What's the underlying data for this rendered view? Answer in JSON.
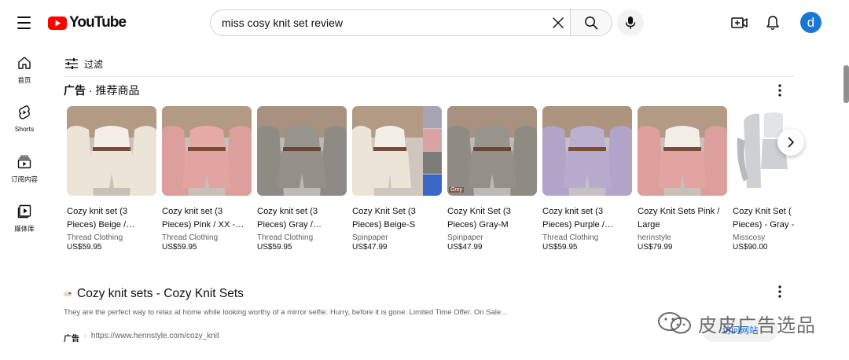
{
  "masthead": {
    "logo_text": "YouTube",
    "search_value": "miss cosy knit set review",
    "avatar_letter": "d",
    "avatar_color": "#1976d2",
    "brand_red": "#ff0000"
  },
  "guide": [
    {
      "label": "首页",
      "icon": "home-icon"
    },
    {
      "label": "Shorts",
      "icon": "shorts-icon"
    },
    {
      "label": "订阅内容",
      "icon": "subscriptions-icon"
    },
    {
      "label": "媒体库",
      "icon": "library-icon"
    }
  ],
  "filter": {
    "label": "过滤"
  },
  "shelf": {
    "ad_label": "广告",
    "separator": " · ",
    "title": "推荐商品",
    "products": [
      {
        "title": "Cozy knit set (3 Pieces) Beige /…",
        "seller": "Thread Clothing",
        "price": "US$59.95",
        "color": "cream"
      },
      {
        "title": "Cozy knit set (3 Pieces) Pink / XX -…",
        "seller": "Thread Clothing",
        "price": "US$59.95",
        "color": "pink"
      },
      {
        "title": "Cozy knit set (3 Pieces) Gray /…",
        "seller": "Thread Clothing",
        "price": "US$59.95",
        "color": "gray"
      },
      {
        "title": "Cozy Knit Set (3 Pieces) Beige-S",
        "seller": "Spinpaper",
        "price": "US$47.99",
        "color": "cream"
      },
      {
        "title": "Cozy Knit Set (3 Pieces) Gray-M",
        "seller": "Spinpaper",
        "price": "US$47.99",
        "color": "gray"
      },
      {
        "title": "Cozy knit set (3 Pieces) Purple /…",
        "seller": "Thread Clothing",
        "price": "US$59.95",
        "color": "purple"
      },
      {
        "title": "Cozy Knit Sets Pink / Large",
        "seller": "herinstyle",
        "price": "US$79.99",
        "color": "pink"
      },
      {
        "title": "Cozy Knit Set ( Pieces) - Gray -",
        "seller": "Misscosy",
        "price": "US$90.00",
        "color": "lightgray"
      }
    ],
    "thumb_badge": "Grey"
  },
  "text_ad": {
    "title": "Cozy knit sets - Cozy Knit Sets",
    "description": "They are the perfect way to relax at home while looking worthy of a mirror selfie. Hurry, before it is gone. Limited Time Offer. On Sale...",
    "badge": "广告",
    "url_prefix": " · ",
    "url": "https://www.herinstyle.com/cozy_knit",
    "visit_label": "访问网站"
  },
  "watermark": {
    "text": "皮皮广告选品"
  }
}
